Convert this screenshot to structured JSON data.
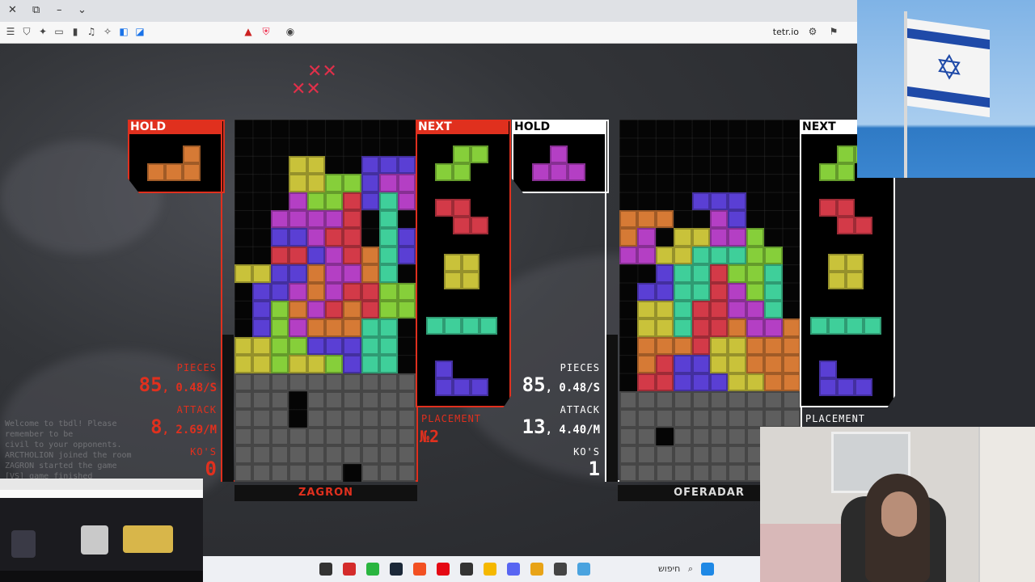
{
  "browser": {
    "url": "tetr.io",
    "tab_controls": [
      "✕",
      "⧉",
      "–",
      "⌄"
    ]
  },
  "player_left": {
    "name": "ZAGRON",
    "hold_label": "HOLD",
    "next_label": "NEXT",
    "pieces_label": "PIECES",
    "pieces_value": "85",
    "pieces_rate": "0.48/S",
    "attack_label": "ATTACK",
    "attack_value": "8",
    "attack_rate": "2.69/M",
    "kos_label": "KO'S",
    "kos_value": "0",
    "placement_label": "PLACEMENT",
    "placement_value": "№2",
    "accent": "#e0301e"
  },
  "player_right": {
    "name": "OFERADAR",
    "hold_label": "HOLD",
    "next_label": "NEXT",
    "pieces_label": "PIECES",
    "pieces_value": "85",
    "pieces_rate": "0.48/S",
    "attack_label": "ATTACK",
    "attack_value": "13",
    "attack_rate": "4.40/M",
    "kos_label": "KO'S",
    "kos_value": "1",
    "placement_label": "PLACEMENT",
    "accent": "#ffffff"
  },
  "chat": {
    "lines": [
      "Welcome to tbdl! Please remember to be",
      "civil to your opponents.",
      "ARCTHOLION joined the room",
      "ZAGRON started the game",
      "[VS] game finished"
    ]
  },
  "taskbar": {
    "search_placeholder": "חיפוש",
    "icons": [
      "media-player-icon",
      "mcafee-icon",
      "whatsapp-icon",
      "steam-icon",
      "brave-icon",
      "netflix-icon",
      "chatgpt-icon",
      "files-icon",
      "discord-icon",
      "chrome-icon",
      "notepad-icon",
      "news-icon",
      "windows-icon"
    ]
  },
  "colors": {
    "T": "#b43fc4",
    "J": "#5a3fd4",
    "L": "#d67a35",
    "O": "#c9c23a",
    "S": "#86cf3a",
    "Z": "#d33a48",
    "I": "#3fcf9a",
    "G": "#5e5e5e"
  },
  "boards": {
    "left": [
      "..........",
      "..........",
      "...OO..JJJ",
      "...OOSSJTT",
      "...TSSZJIT",
      "..TTTTZ.I.",
      "..JJTZZ.IJ",
      "..ZZJTZLIJ",
      "OOJJLTTLI.",
      ".JJTLTZZSS",
      ".JSLTZLZSS",
      ".JSTLLLII.",
      "OOSSJJJII.",
      "OOSOOSJII.",
      "GGGGGGGGGG",
      "GGG.GGGGGG",
      "GGG.GGGGGG",
      "GGGGGGGGGG",
      "GGGGGGGGGG",
      "GGGGGG.GGG"
    ],
    "right": [
      "..........",
      "..........",
      "..........",
      "..........",
      "....JJJ...",
      "LLL..TJ...",
      "LT.OOTTS..",
      "TTOOIIISS.",
      "..JIIZSSI.",
      ".JJIIZTSI.",
      ".OOIZZTTI.",
      ".OOIZZLTTL",
      ".LLLZOOLLL",
      ".LZJJOOLLL",
      ".ZZJJJOOLL",
      "GGGGGGGGGG",
      "GGGGGGGGGG",
      "GG.GGGGGGG",
      "GGGGGGGGGG",
      "GGGGGGGGGG"
    ]
  }
}
